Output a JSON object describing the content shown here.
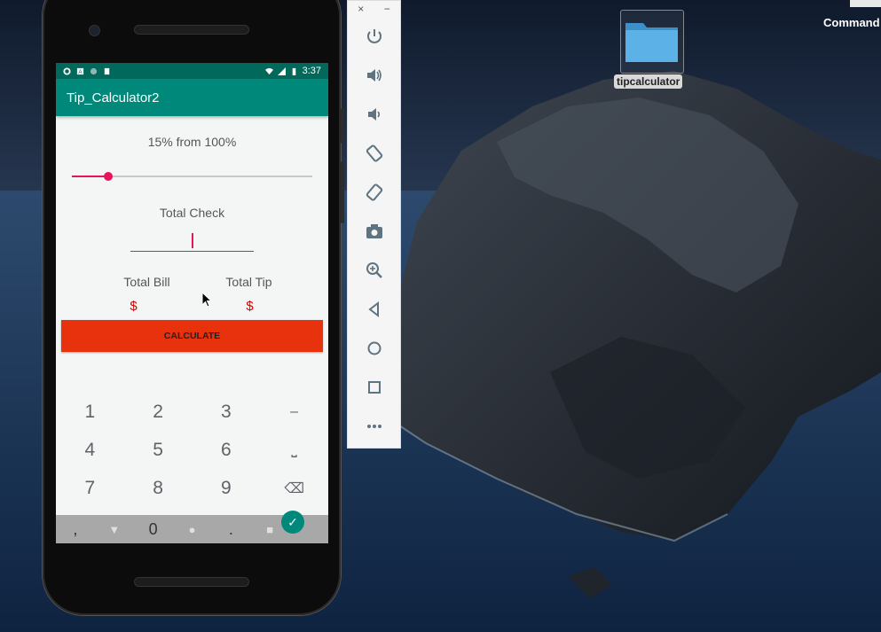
{
  "desktop": {
    "folder_label": "tipcalculator",
    "top_right_label": "Command"
  },
  "emulator_toolbar": {
    "close_glyph": "×",
    "minimize_glyph": "−",
    "buttons": [
      "power-icon",
      "volume-up-icon",
      "volume-down-icon",
      "rotate-left-icon",
      "rotate-right-icon",
      "camera-icon",
      "zoom-icon",
      "back-icon",
      "home-icon",
      "overview-icon",
      "more-icon"
    ]
  },
  "status_bar": {
    "time": "3:37"
  },
  "app": {
    "title": "Tip_Calculator2",
    "tip_percent_label": "15% from 100%",
    "tip_percent": 15,
    "total_check_label": "Total Check",
    "total_check_value": "",
    "total_bill_label": "Total Bill",
    "total_tip_label": "Total Tip",
    "total_bill_value": "$",
    "total_tip_value": "$",
    "calculate_label": "CALCULATE",
    "accent_color": "#e6145c",
    "appbar_color": "#00897b",
    "button_color": "#e8310d"
  },
  "keyboard": {
    "rows": [
      [
        "1",
        "2",
        "3",
        "–"
      ],
      [
        "4",
        "5",
        "6",
        "⎵"
      ],
      [
        "7",
        "8",
        "9",
        "⌫"
      ]
    ],
    "bottom_row": [
      ",",
      "0",
      "."
    ]
  }
}
